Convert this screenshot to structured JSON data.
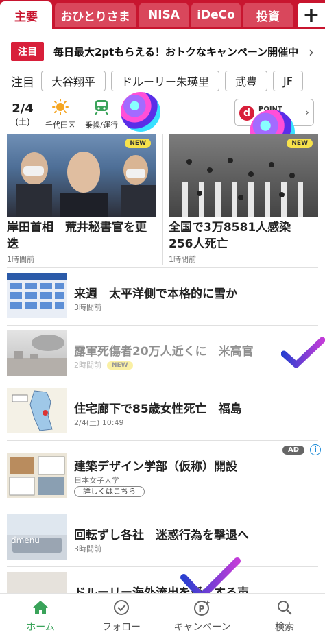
{
  "tabs": [
    {
      "label": "主要",
      "active": true
    },
    {
      "label": "おひとりさま"
    },
    {
      "label": "NISA"
    },
    {
      "label": "iDeCo"
    },
    {
      "label": "投資"
    }
  ],
  "tab_add_label": "+",
  "notice": {
    "badge": "注目",
    "text": "毎日最大2ptもらえる！おトクなキャンペーン開催中",
    "chevron": "›"
  },
  "trending": {
    "label": "注目",
    "chips": [
      "大谷翔平",
      "ドルーリー朱瑛里",
      "武豊",
      "JF"
    ]
  },
  "info": {
    "date": "2/4",
    "weekday": "(土)",
    "weather_label": "千代田区",
    "weather_icon": "sun-icon",
    "transit_label": "乗換/運行",
    "transit_icon": "train-icon",
    "dpoint_logo": "d",
    "dpoint_text": "POINT",
    "dpoint_chevron": "›"
  },
  "top_stories": [
    {
      "title": "岸田首相　荒井秘書官を更迭",
      "time": "1時間前",
      "badge": "NEW"
    },
    {
      "title": "全国で3万8581人感染　256人死亡",
      "time": "1時間前",
      "badge": "NEW"
    }
  ],
  "articles": [
    {
      "title": "来週　太平洋側で本格的に雪か",
      "meta": "3時間前"
    },
    {
      "title": "露軍死傷者20万人近くに　米高官",
      "meta": "2時間前",
      "badge": "NEW"
    },
    {
      "title": "住宅廊下で85歳女性死亡　福島",
      "meta": "2/4(土) 10:49"
    },
    {
      "title": "建築デザイン学部（仮称）開設",
      "meta": "日本女子大学",
      "ad": "AD",
      "button": "詳しくはこちら",
      "info_icon": "i"
    },
    {
      "title": "回転ずし各社　迷惑行為を撃退へ",
      "meta": "3時間前"
    },
    {
      "title": "ドルーリー海外流出を懸念する声"
    }
  ],
  "bottom_nav": [
    {
      "label": "ホーム",
      "icon": "home-icon",
      "active": true
    },
    {
      "label": "フォロー",
      "icon": "follow-check-icon"
    },
    {
      "label": "キャンペーン",
      "icon": "campaign-point-icon"
    },
    {
      "label": "検索",
      "icon": "search-icon"
    }
  ],
  "colors": {
    "brand": "#c8152f",
    "accent_green": "#3aa35a",
    "new_badge": "#f7e24b"
  }
}
